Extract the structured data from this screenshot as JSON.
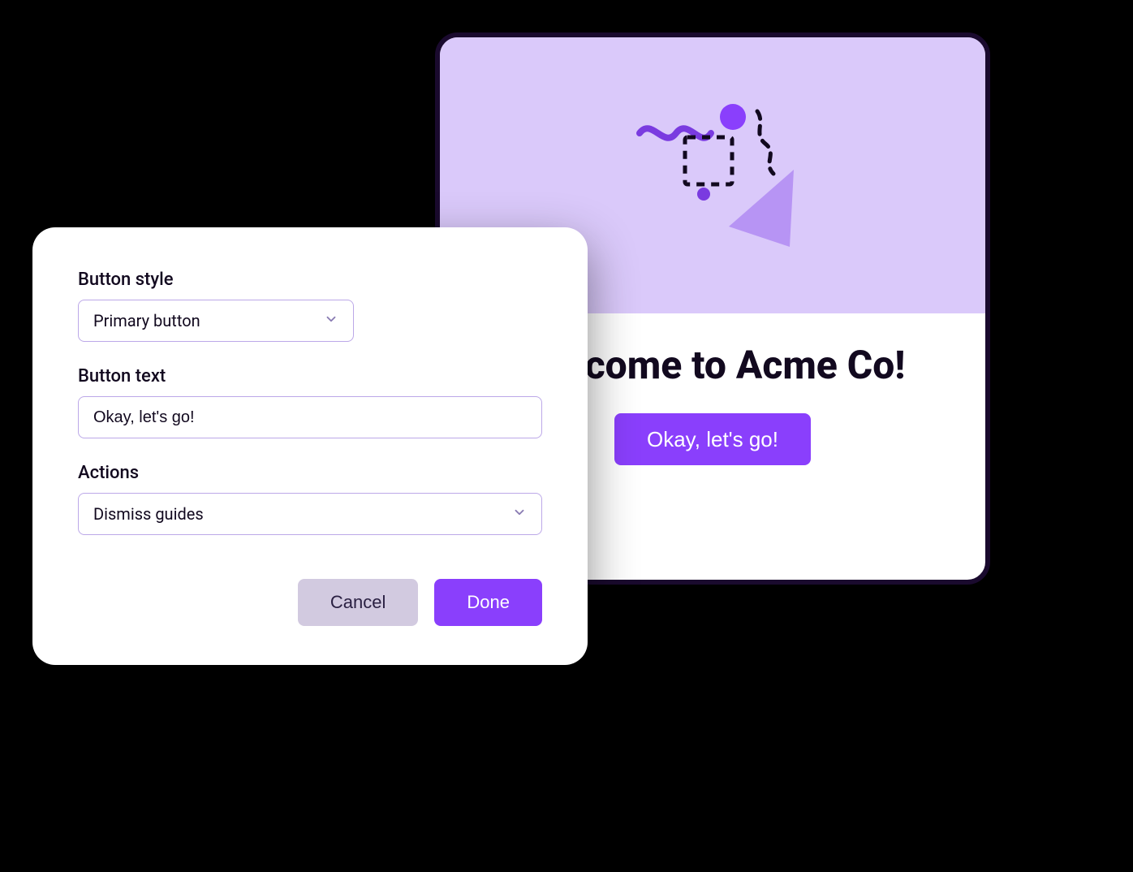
{
  "editor": {
    "buttonStyle": {
      "label": "Button style",
      "value": "Primary button"
    },
    "buttonText": {
      "label": "Button text",
      "value": "Okay, let's go!"
    },
    "actions": {
      "label": "Actions",
      "value": "Dismiss guides"
    },
    "cancel_label": "Cancel",
    "done_label": "Done"
  },
  "preview": {
    "title": "Welcome to Acme Co!",
    "cta_label": "Okay, let's go!"
  },
  "colors": {
    "accent": "#8a3ffc",
    "heroBg": "#dac9fa",
    "border": "#bca8e8",
    "secondaryBtn": "#d2cae0"
  }
}
